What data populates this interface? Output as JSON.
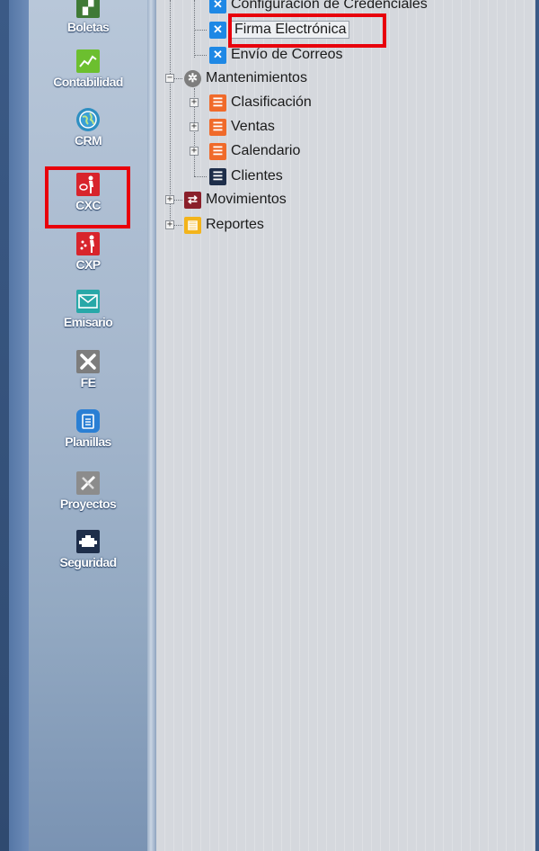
{
  "sidebar": {
    "modules": [
      {
        "label": "Boletas",
        "icon": "document-chart-icon",
        "color": "#3f7a36"
      },
      {
        "label": "Contabilidad",
        "icon": "line-chart-icon",
        "color": "#6cbf2f"
      },
      {
        "label": "CRM",
        "icon": "globe-icon",
        "color": "#2e8fc2"
      },
      {
        "label": "CXC",
        "icon": "person-money-icon",
        "color": "#d8242c"
      },
      {
        "label": "CXP",
        "icon": "person-coins-icon",
        "color": "#d8242c"
      },
      {
        "label": "Emisario",
        "icon": "envelope-icon",
        "color": "#28a8a8"
      },
      {
        "label": "FE",
        "icon": "tools-icon",
        "color": "#7d7d7d"
      },
      {
        "label": "Planillas",
        "icon": "clipboard-icon",
        "color": "#2a7fd4"
      },
      {
        "label": "Proyectos",
        "icon": "ruler-pencil-icon",
        "color": "#8c8c8c"
      },
      {
        "label": "Seguridad",
        "icon": "engine-icon",
        "color": "#1e2e4a"
      }
    ]
  },
  "tree": {
    "config_credenciales": "Configuración de Credenciales",
    "firma_electronica": "Firma Electrónica",
    "envio_correos": "Envío de Correos",
    "mantenimientos": "Mantenimientos",
    "clasificacion": "Clasificación",
    "ventas": "Ventas",
    "calendario": "Calendario",
    "clientes": "Clientes",
    "movimientos": "Movimientos",
    "reportes": "Reportes"
  },
  "colors": {
    "highlight": "#e8000b",
    "tools_icon": "#1e88e5",
    "list_icon": "#f06a2a",
    "clientes_icon": "#1e2e4a",
    "movimientos_icon": "#8a1f2a",
    "reportes_icon": "#f3b41b",
    "gear_icon": "#7d7d7d"
  }
}
